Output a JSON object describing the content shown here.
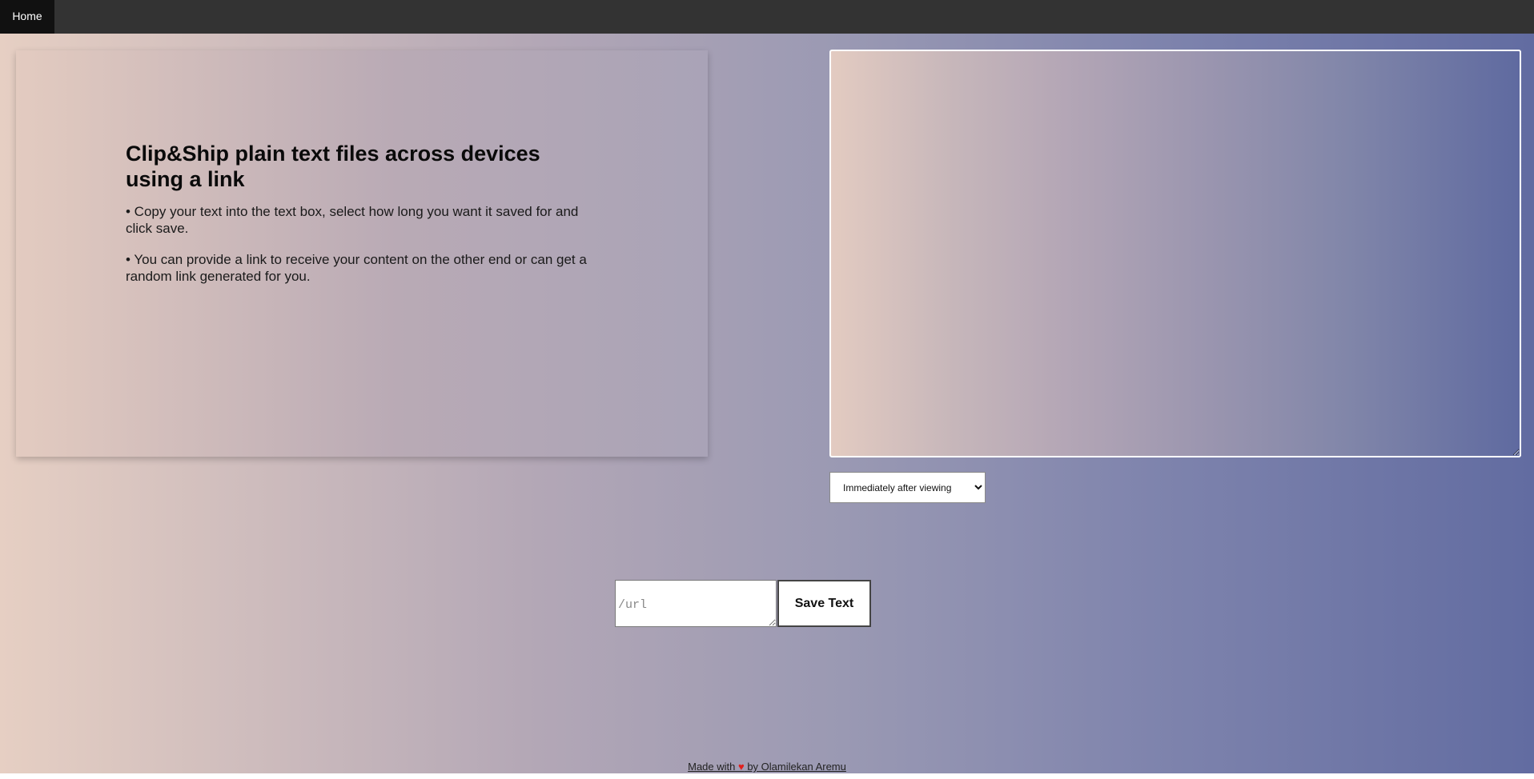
{
  "nav": {
    "home_label": "Home"
  },
  "info": {
    "title": "Clip&Ship plain text files across devices using a link",
    "bullets": [
      "• Copy your text into the text box, select how long you want it saved for and click save.",
      "• You can provide a link to receive your content on the other end or can get a random link generated for you."
    ]
  },
  "editor": {
    "value": ""
  },
  "expiry": {
    "selected": "Immediately after viewing"
  },
  "url": {
    "placeholder": "/url",
    "value": ""
  },
  "save": {
    "label": "Save Text"
  },
  "footer": {
    "prefix": "Made with ",
    "heart": "♥",
    "suffix": " by Olamilekan Aremu"
  },
  "colors": {
    "nav_bg": "#333333",
    "nav_active_bg": "#111111",
    "heart": "#e0201c"
  }
}
